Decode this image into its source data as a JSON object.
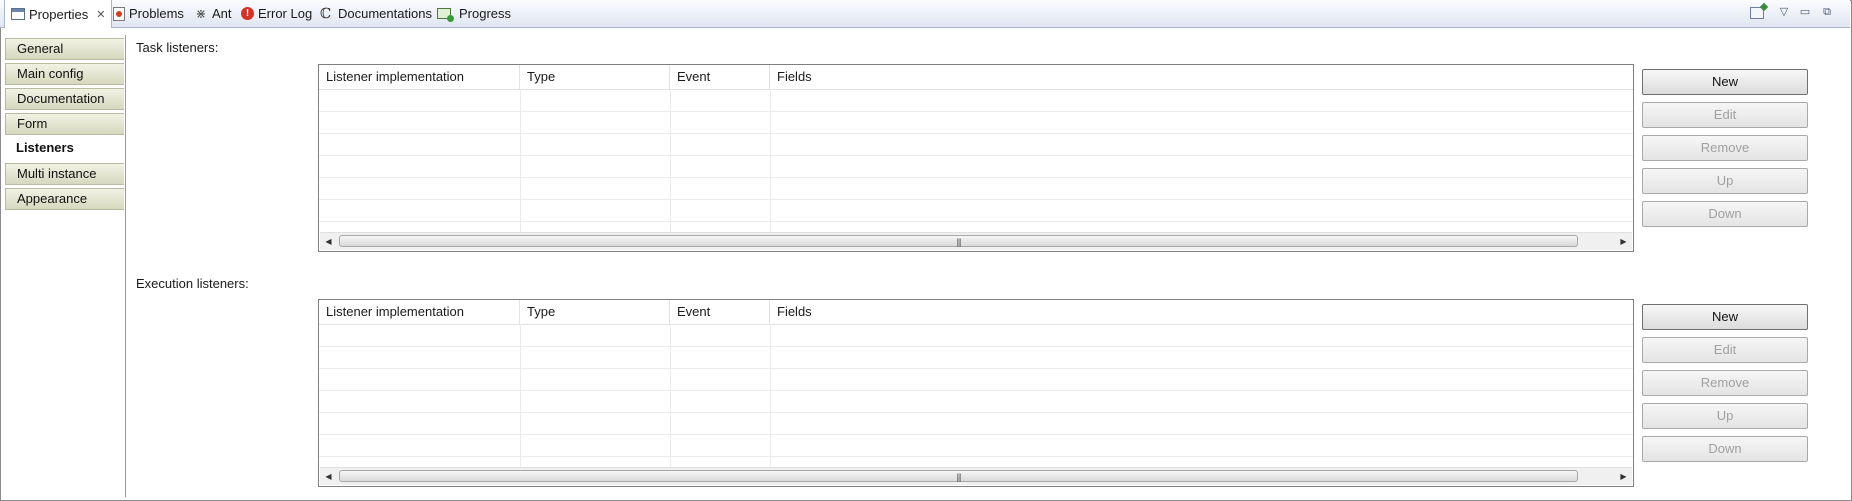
{
  "tabs": [
    {
      "label": "Properties",
      "icon": "properties-icon",
      "active": true
    },
    {
      "label": "Problems",
      "icon": "problems-icon"
    },
    {
      "label": "Ant",
      "icon": "ant-icon"
    },
    {
      "label": "Error Log",
      "icon": "error-log-icon"
    },
    {
      "label": "Documentations",
      "icon": "documentation-icon"
    },
    {
      "label": "Progress",
      "icon": "progress-icon"
    }
  ],
  "window_controls": [
    "pin-view-icon",
    "view-menu-icon",
    "minimize-icon",
    "restore-icon"
  ],
  "sidebar": {
    "items": [
      {
        "label": "General"
      },
      {
        "label": "Main config"
      },
      {
        "label": "Documentation"
      },
      {
        "label": "Form"
      },
      {
        "label": "Listeners",
        "selected": true
      },
      {
        "label": "Multi instance"
      },
      {
        "label": "Appearance"
      }
    ]
  },
  "task_listeners": {
    "label": "Task listeners:",
    "columns": [
      "Listener implementation",
      "Type",
      "Event",
      "Fields"
    ],
    "rows": [],
    "buttons": [
      {
        "label": "New",
        "enabled": true
      },
      {
        "label": "Edit",
        "enabled": false
      },
      {
        "label": "Remove",
        "enabled": false
      },
      {
        "label": "Up",
        "enabled": false
      },
      {
        "label": "Down",
        "enabled": false
      }
    ]
  },
  "execution_listeners": {
    "label": "Execution listeners:",
    "columns": [
      "Listener implementation",
      "Type",
      "Event",
      "Fields"
    ],
    "rows": [],
    "buttons": [
      {
        "label": "New",
        "enabled": true
      },
      {
        "label": "Edit",
        "enabled": false
      },
      {
        "label": "Remove",
        "enabled": false
      },
      {
        "label": "Up",
        "enabled": false
      },
      {
        "label": "Down",
        "enabled": false
      }
    ]
  },
  "colors": {
    "tab_bar": "#dfe6f1",
    "sidebar_button": "#d6d8be",
    "border": "#7f7f7f"
  }
}
